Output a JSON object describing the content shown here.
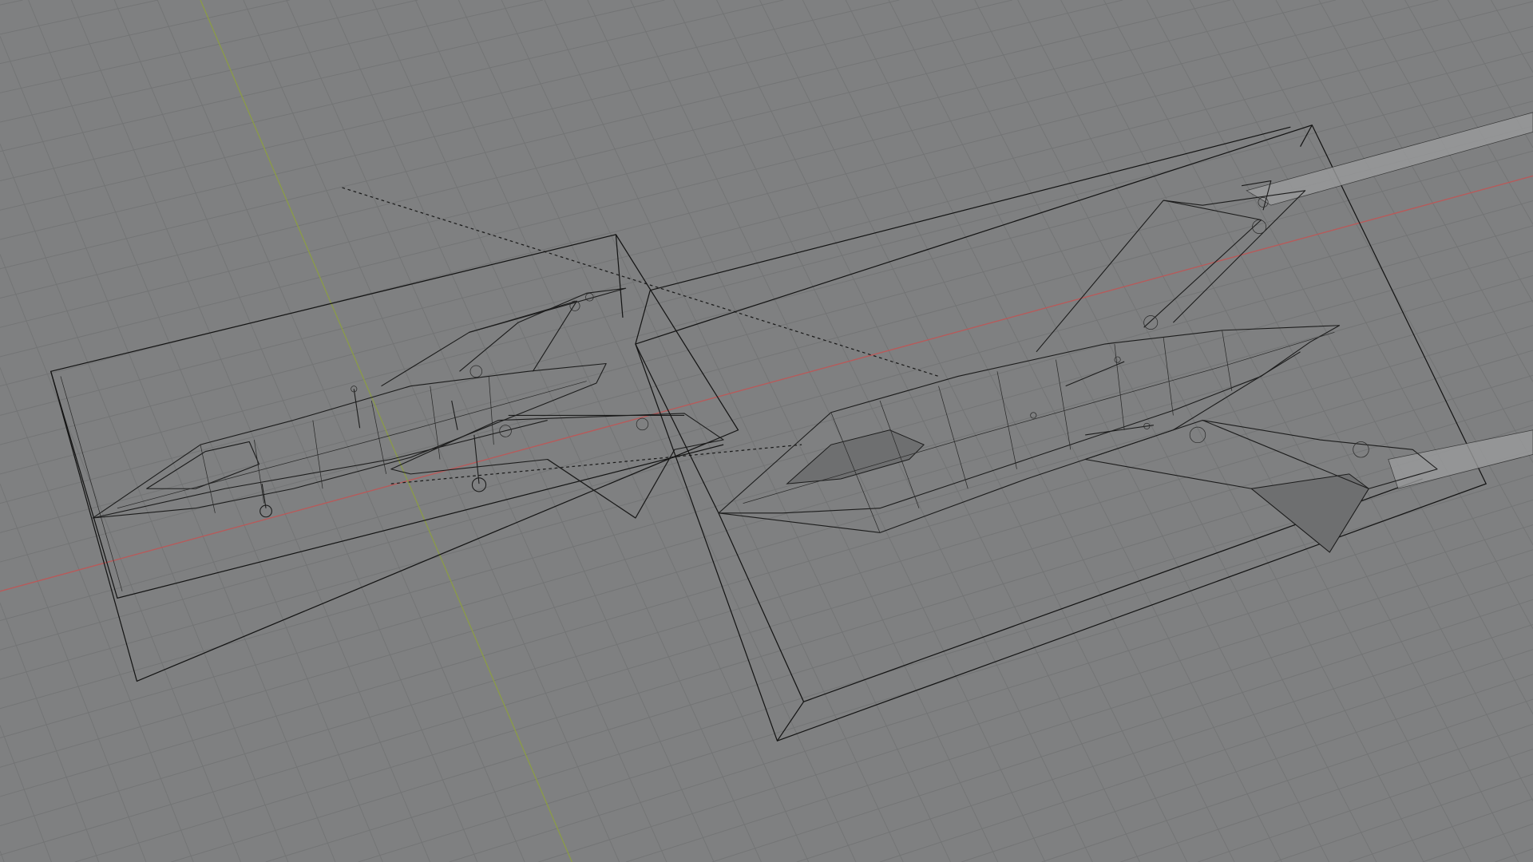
{
  "viewport": {
    "mode": "wireframe",
    "colors": {
      "background": "#7f8081",
      "grid": "#737475",
      "x_axis": "#b85a5a",
      "y_axis": "#8a9a4a",
      "wire": "#1c1c1c"
    }
  }
}
